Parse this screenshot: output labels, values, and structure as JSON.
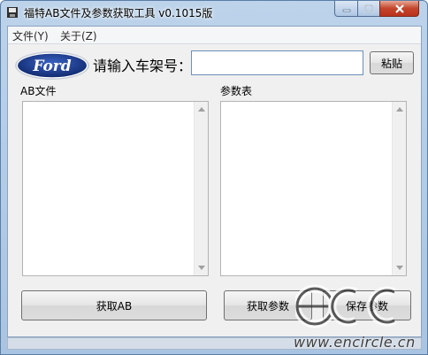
{
  "window": {
    "title": "福特AB文件及参数获取工具  v0.1015版"
  },
  "menu": {
    "items": [
      "文件(Y)",
      "关于(Z)"
    ]
  },
  "logo": {
    "brand": "Ford",
    "color": "#1b3a8c"
  },
  "vin": {
    "label": "请输入车架号：",
    "value": "",
    "paste_button": "粘贴"
  },
  "ab_files": {
    "label": "AB文件",
    "items": []
  },
  "params": {
    "label": "参数表",
    "items": []
  },
  "buttons": {
    "get_ab": "获取AB",
    "get_params": "获取参数",
    "save_params": "保存参数"
  },
  "watermark": {
    "logo_text": "ecc",
    "url": "www.encircle.cn"
  },
  "colors": {
    "titlebar": "#bcd3ea",
    "close_button": "#c4452b",
    "client": "#f0f0f0"
  }
}
